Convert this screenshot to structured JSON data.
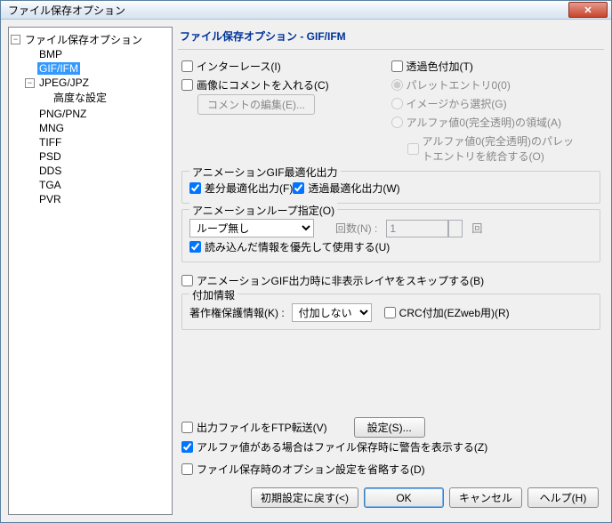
{
  "title": "ファイル保存オプション",
  "tree": {
    "root": "ファイル保存オプション",
    "items": [
      "BMP",
      "GIF/IFM",
      "JPEG/JPZ",
      "PNG/PNZ",
      "MNG",
      "TIFF",
      "PSD",
      "DDS",
      "TGA",
      "PVR"
    ],
    "jpeg_child": "高度な設定",
    "selected": "GIF/IFM"
  },
  "main": {
    "heading": "ファイル保存オプション - GIF/IFM",
    "interlace": "インターレース(I)",
    "comment_chk": "画像にコメントを入れる(C)",
    "comment_btn": "コメントの編集(E)...",
    "trans_add": "透過色付加(T)",
    "palette_entry": "パレットエントリ0(0)",
    "from_image": "イメージから選択(G)",
    "alpha_region": "アルファ値0(完全透明)の領域(A)",
    "alpha_merge": "アルファ値0(完全透明)のパレットエントリを統合する(O)",
    "anim_opt_title": "アニメーションGIF最適化出力",
    "diff_opt": "差分最適化出力(F)",
    "trans_opt": "透過最適化出力(W)",
    "loop_title": "アニメーションループ指定(O)",
    "loop_select": "ループ無し",
    "loop_count_lbl": "回数(N) :",
    "loop_count_val": "1",
    "loop_unit": "回",
    "use_embedded": "読み込んだ情報を優先して使用する(U)",
    "skip_hidden": "アニメーションGIF出力時に非表示レイヤをスキップする(B)",
    "addinfo_title": "付加情報",
    "copyright_lbl": "著作権保護情報(K) :",
    "copyright_sel": "付加しない",
    "crc": "CRC付加(EZweb用)(R)",
    "ftp": "出力ファイルをFTP転送(V)",
    "ftp_btn": "設定(S)...",
    "alpha_warn": "アルファ値がある場合はファイル保存時に警告を表示する(Z)",
    "omit_opts": "ファイル保存時のオプション設定を省略する(D)"
  },
  "footer": {
    "reset": "初期設定に戻す(<)",
    "ok": "OK",
    "cancel": "キャンセル",
    "help": "ヘルプ(H)"
  }
}
